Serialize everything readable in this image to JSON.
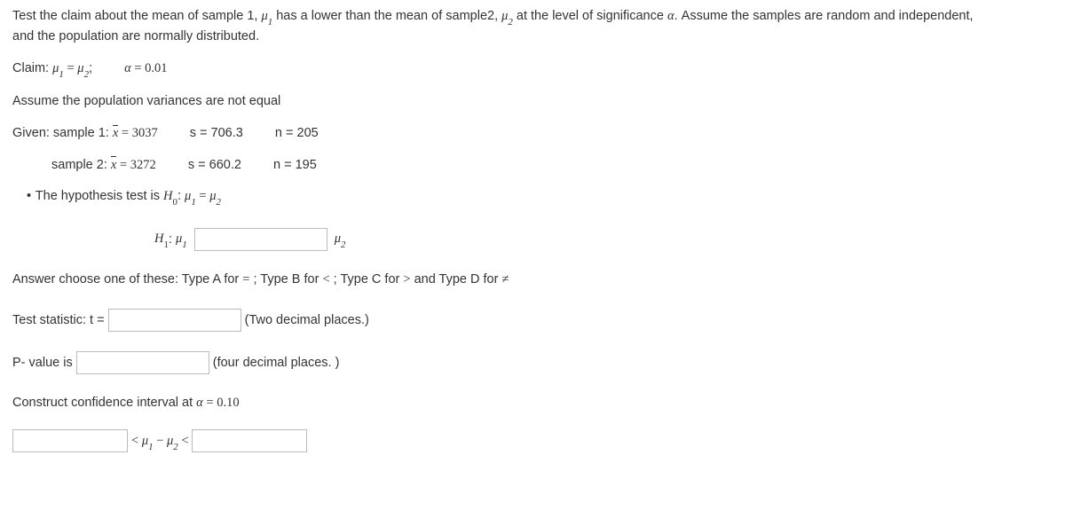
{
  "intro": {
    "line1a": "Test the claim about the mean of sample 1, ",
    "mu1": "μ",
    "sub1": "1",
    "line1b": " has a lower than the mean of sample2, ",
    "mu2": "μ",
    "sub2": "2",
    "line1c": " at the level of significance ",
    "alpha": "α",
    "line1d": ". Assume the samples are random and independent,",
    "line2": "and the population are normally distributed."
  },
  "claim": {
    "label": "Claim: ",
    "mu1": "μ",
    "s1": "1",
    "eq": " = ",
    "mu2": "μ",
    "s2": "2",
    "semi": ";",
    "alpha": "α",
    "aeq": " = ",
    "aval": "0.01"
  },
  "assume": "Assume the population variances are not equal",
  "given": {
    "label": "Given:  sample 1: ",
    "xbar": "x",
    "eq": " = ",
    "mean1": "3037",
    "s_lbl": "s = ",
    "s1": "706.3",
    "n_lbl": "n = ",
    "n1": "205",
    "s2label": "sample 2: ",
    "mean2": "3272",
    "s2": "660.2",
    "n2": "195"
  },
  "hypo": {
    "bullet": "•",
    "text": " The hypothesis test is ",
    "H0": "H",
    "zero": "0",
    "colon": ": ",
    "mu": "μ",
    "s1": "1",
    "eq": " = ",
    "s2": "2"
  },
  "h1": {
    "H": "H",
    "one": "1",
    "colon": ": ",
    "mu": "μ",
    "s1": "1",
    "mu2": "μ",
    "s2": "2"
  },
  "ans_instruction": {
    "a": "Answer choose one of these: Type A for ",
    "eq": "=",
    "b": " ; Type B for ",
    "lt": "<",
    "c": " ; Type C for ",
    "gt": ">",
    "d": " and Type D for ",
    "ne": "≠"
  },
  "test_stat": {
    "label": "Test statistic: t = ",
    "note": " (Two decimal places.)"
  },
  "pval": {
    "label": "P- value is ",
    "note": " (four decimal places. )"
  },
  "ci": {
    "label": "Construct confidence interval at ",
    "alpha": "α",
    "eq": " = ",
    "val": " 0.10",
    "lt1": " < ",
    "mu": "μ",
    "s1": "1",
    "minus": " − ",
    "s2": "2",
    "lt2": " < "
  }
}
